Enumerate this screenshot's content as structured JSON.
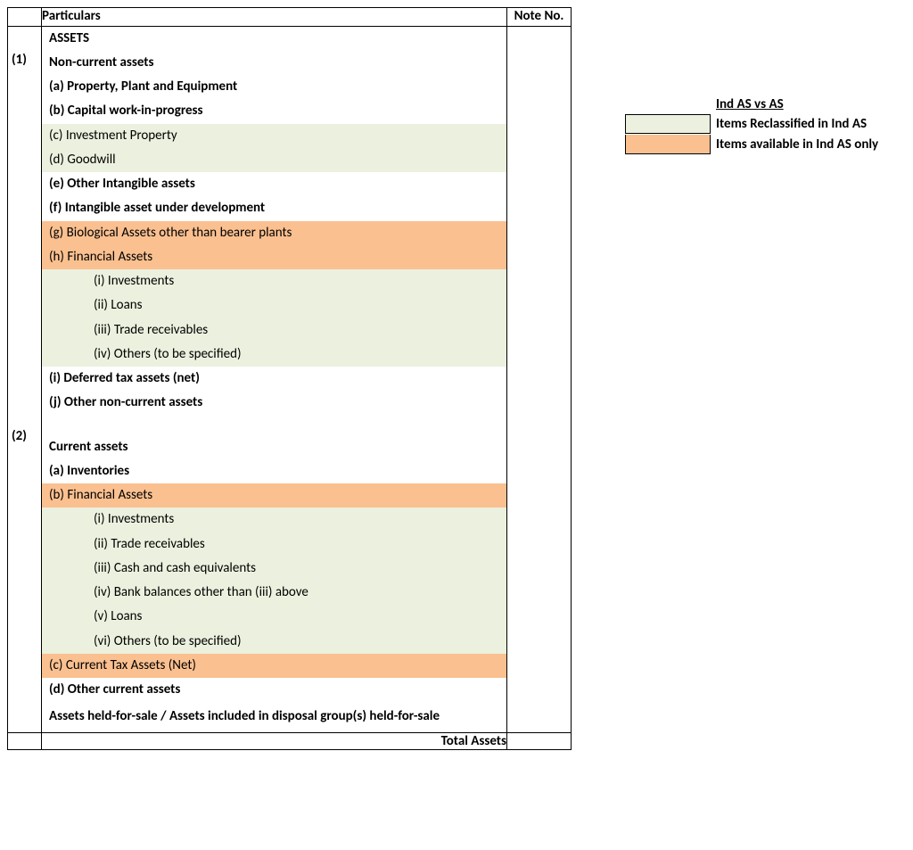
{
  "header": {
    "particulars": "Particulars",
    "note": "Note No."
  },
  "sections": {
    "num1": "(1)",
    "num2": "(2)",
    "assets_title": "ASSETS",
    "nca_title": "Non-current assets",
    "nca_a": "(a) Property, Plant and Equipment",
    "nca_b": "(b) Capital work-in-progress",
    "nca_c": "(c) Investment Property",
    "nca_d": "(d) Goodwill",
    "nca_e": "(e) Other Intangible assets",
    "nca_f": "(f) Intangible asset under development",
    "nca_g": "(g) Biological Assets other than bearer plants",
    "nca_h": "(h) Financial Assets",
    "nca_h_i": "(i) Investments",
    "nca_h_ii": "(ii) Loans",
    "nca_h_iii": "(iii) Trade receivables",
    "nca_h_iv": "(iv) Others (to be specified)",
    "nca_i": "(i) Deferred tax assets (net)",
    "nca_j": "(j) Other non-current assets",
    "ca_title": "Current assets",
    "ca_a": "(a) Inventories",
    "ca_b": "(b) Financial Assets",
    "ca_b_i": "(i) Investments",
    "ca_b_ii": "(ii) Trade receivables",
    "ca_b_iii": "(iii) Cash and cash equivalents",
    "ca_b_iv": "(iv) Bank balances other than (iii) above",
    "ca_b_v": "(v) Loans",
    "ca_b_vi": "(vi) Others (to be specified)",
    "ca_c": "(c) Current Tax Assets (Net)",
    "ca_d": "(d) Other current assets",
    "held_for_sale": "Assets held-for-sale / Assets included in disposal group(s) held-for-sale",
    "total": "Total Assets"
  },
  "legend": {
    "title": "Ind AS vs AS",
    "item1": "Items Reclassified in Ind AS",
    "item2": "Items available in Ind AS only"
  },
  "colors": {
    "reclassified": "#ebf1de",
    "indas_only": "#fac090"
  }
}
